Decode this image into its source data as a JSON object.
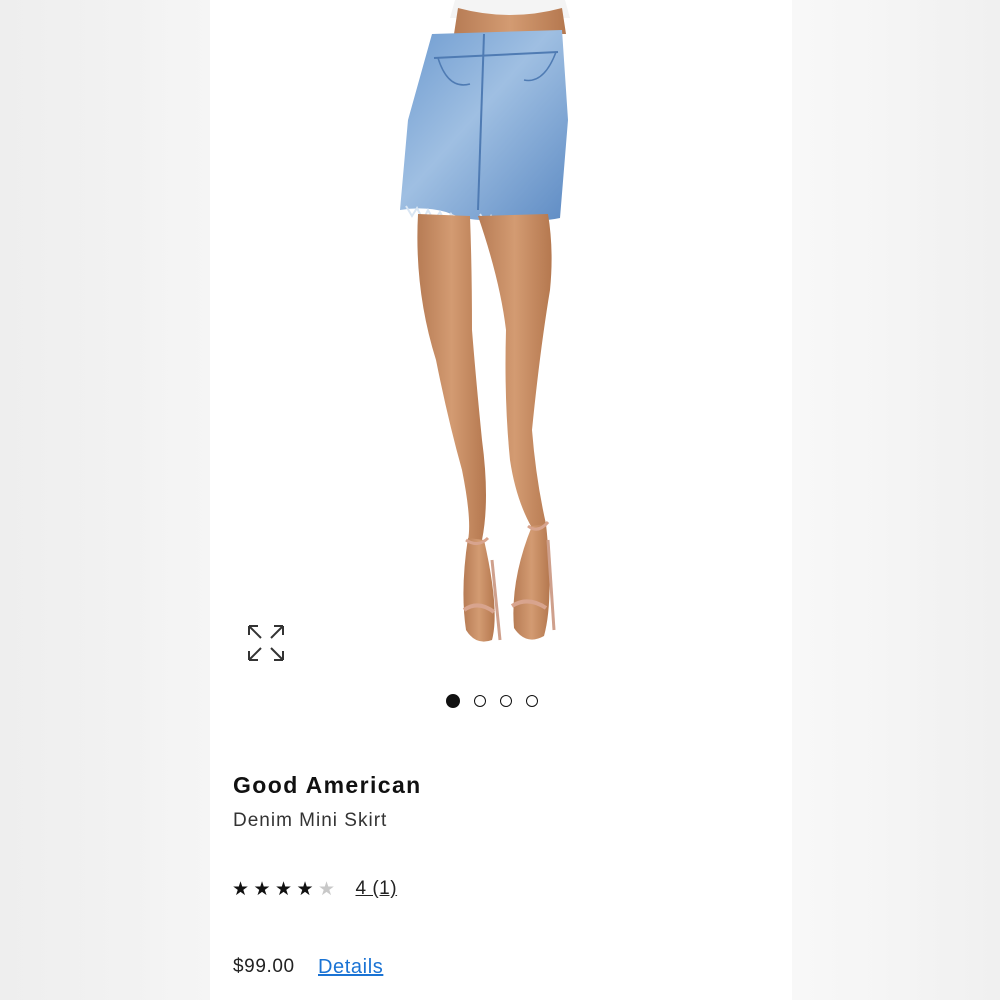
{
  "product": {
    "brand": "Good American",
    "name": "Denim Mini Skirt",
    "price": "$99.00",
    "details_label": "Details",
    "rating": {
      "stars": 4,
      "max_stars": 5,
      "link_text": "4 (1)"
    }
  },
  "gallery": {
    "image_count": 4,
    "active_index": 0,
    "expand_icon": "expand-arrows-icon"
  },
  "colors": {
    "link": "#1a73d4",
    "text": "#111111",
    "denim": "#7ea6d3"
  }
}
